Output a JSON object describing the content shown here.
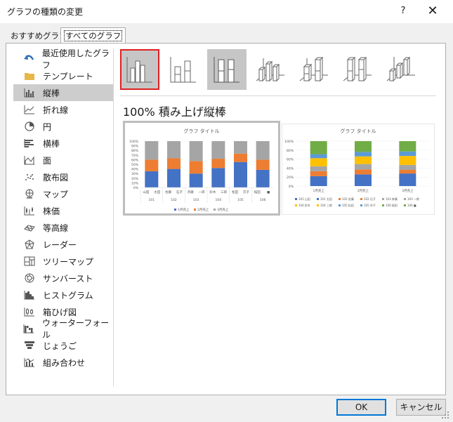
{
  "window": {
    "title": "グラフの種類の変更",
    "help_label": "?",
    "close_label": "✕"
  },
  "tabs": [
    {
      "label": "おすすめグラフ",
      "selected": false
    },
    {
      "label": "すべてのグラフ",
      "selected": true
    }
  ],
  "sidebar": {
    "items": [
      {
        "label": "最近使用したグラフ",
        "icon": "undo-arrow-icon"
      },
      {
        "label": "テンプレート",
        "icon": "folder-icon"
      },
      {
        "label": "縦棒",
        "icon": "column-chart-icon",
        "selected": true
      },
      {
        "label": "折れ線",
        "icon": "line-chart-icon"
      },
      {
        "label": "円",
        "icon": "pie-chart-icon"
      },
      {
        "label": "横棒",
        "icon": "bar-chart-icon"
      },
      {
        "label": "面",
        "icon": "area-chart-icon"
      },
      {
        "label": "散布図",
        "icon": "scatter-chart-icon"
      },
      {
        "label": "マップ",
        "icon": "map-chart-icon"
      },
      {
        "label": "株価",
        "icon": "stock-chart-icon"
      },
      {
        "label": "等高線",
        "icon": "surface-chart-icon"
      },
      {
        "label": "レーダー",
        "icon": "radar-chart-icon"
      },
      {
        "label": "ツリーマップ",
        "icon": "treemap-icon"
      },
      {
        "label": "サンバースト",
        "icon": "sunburst-icon"
      },
      {
        "label": "ヒストグラム",
        "icon": "histogram-icon"
      },
      {
        "label": "箱ひげ図",
        "icon": "box-whisker-icon"
      },
      {
        "label": "ウォーターフォール",
        "icon": "waterfall-icon"
      },
      {
        "label": "じょうご",
        "icon": "funnel-icon"
      },
      {
        "label": "組み合わせ",
        "icon": "combo-chart-icon"
      }
    ]
  },
  "subtypes": [
    {
      "name": "clustered-column",
      "selected": true
    },
    {
      "name": "stacked-column",
      "selected": false
    },
    {
      "name": "100-stacked-column",
      "selected": false,
      "highlighted": true
    },
    {
      "name": "3d-clustered-column",
      "selected": false
    },
    {
      "name": "3d-stacked-column",
      "selected": false
    },
    {
      "name": "3d-100-stacked-column",
      "selected": false
    },
    {
      "name": "3d-column",
      "selected": false
    }
  ],
  "selected_type_title": "100% 積み上げ縦棒",
  "colors": {
    "blue": "#4472c4",
    "orange": "#ed7d31",
    "gray": "#a5a5a5",
    "yellow": "#ffc000",
    "lightblue": "#5b9bd5",
    "green": "#70ad47",
    "selection_red": "#e02020",
    "ok_border": "#0078d7"
  },
  "preview1": {
    "title": "グラフ タイトル",
    "y_ticks": [
      "100%",
      "90%",
      "80%",
      "70%",
      "60%",
      "50%",
      "40%",
      "30%",
      "20%",
      "10%",
      "0%"
    ],
    "categories": [
      "山田",
      "太田",
      "佐藤",
      "石子",
      "斉藤",
      "一郎",
      "鈴木",
      "三郎",
      "松田",
      "京子",
      "桜田",
      "■"
    ],
    "groups": [
      "101",
      "102",
      "103",
      "104",
      "105",
      "106"
    ],
    "legend": [
      "1月売上",
      "2月売上",
      "3月売上"
    ],
    "chart_data": {
      "type": "bar",
      "stacked_percent": true,
      "series": [
        {
          "name": "1月売上",
          "values": [
            35,
            40,
            30,
            42,
            55,
            38
          ]
        },
        {
          "name": "2月売上",
          "values": [
            25,
            23,
            27,
            20,
            18,
            22
          ]
        },
        {
          "name": "3月売上",
          "values": [
            40,
            37,
            43,
            38,
            27,
            40
          ]
        }
      ]
    }
  },
  "preview2": {
    "title": "グラフ タイトル",
    "y_ticks": [
      "100%",
      "80%",
      "60%",
      "40%",
      "20%",
      "0%"
    ],
    "categories": [
      "1月売上",
      "2月売上",
      "3月売上"
    ],
    "legend": [
      "101 山田",
      "101 太田",
      "102 佐藤",
      "102 石子",
      "103 斉藤",
      "103 一郎",
      "104 鈴木",
      "104 三郎",
      "105 松田",
      "105 京子",
      "106 桜田",
      "106 ■"
    ],
    "chart_data": {
      "type": "bar",
      "stacked_percent": true,
      "series": [
        {
          "name": "101",
          "values": [
            22,
            26,
            28
          ]
        },
        {
          "name": "102",
          "values": [
            11,
            11,
            8
          ]
        },
        {
          "name": "103",
          "values": [
            11,
            12,
            11
          ]
        },
        {
          "name": "104",
          "values": [
            18,
            17,
            20
          ]
        },
        {
          "name": "105",
          "values": [
            9,
            10,
            10
          ]
        },
        {
          "name": "106",
          "values": [
            29,
            24,
            23
          ]
        }
      ]
    }
  },
  "footer": {
    "ok_label": "OK",
    "cancel_label": "キャンセル"
  }
}
